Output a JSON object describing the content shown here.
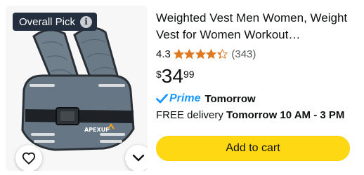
{
  "badge": {
    "label": "Overall Pick",
    "icon": "info-icon"
  },
  "product": {
    "image_alt": "weighted vest",
    "brand_mark": "APEXUP",
    "title_lines": [
      "Weighted Vest Men Women, Weight",
      "Vest for Women Workout…"
    ],
    "rating": "4.3",
    "stars": 4.3,
    "review_count": "(343)",
    "price": {
      "symbol": "$",
      "whole": "34",
      "fraction": "99"
    },
    "prime": {
      "label": "Prime",
      "eta": "Tomorrow"
    },
    "delivery": {
      "prefix": "FREE delivery",
      "window": "Tomorrow 10 AM - 3 PM"
    }
  },
  "actions": {
    "add_to_cart": "Add to cart",
    "favorite_icon": "heart-icon",
    "more_icon": "chevron-down-icon"
  },
  "colors": {
    "badge_bg": "#232f3e",
    "star": "#de7921",
    "prime": "#1a98ff",
    "cart_button": "#ffd814"
  }
}
